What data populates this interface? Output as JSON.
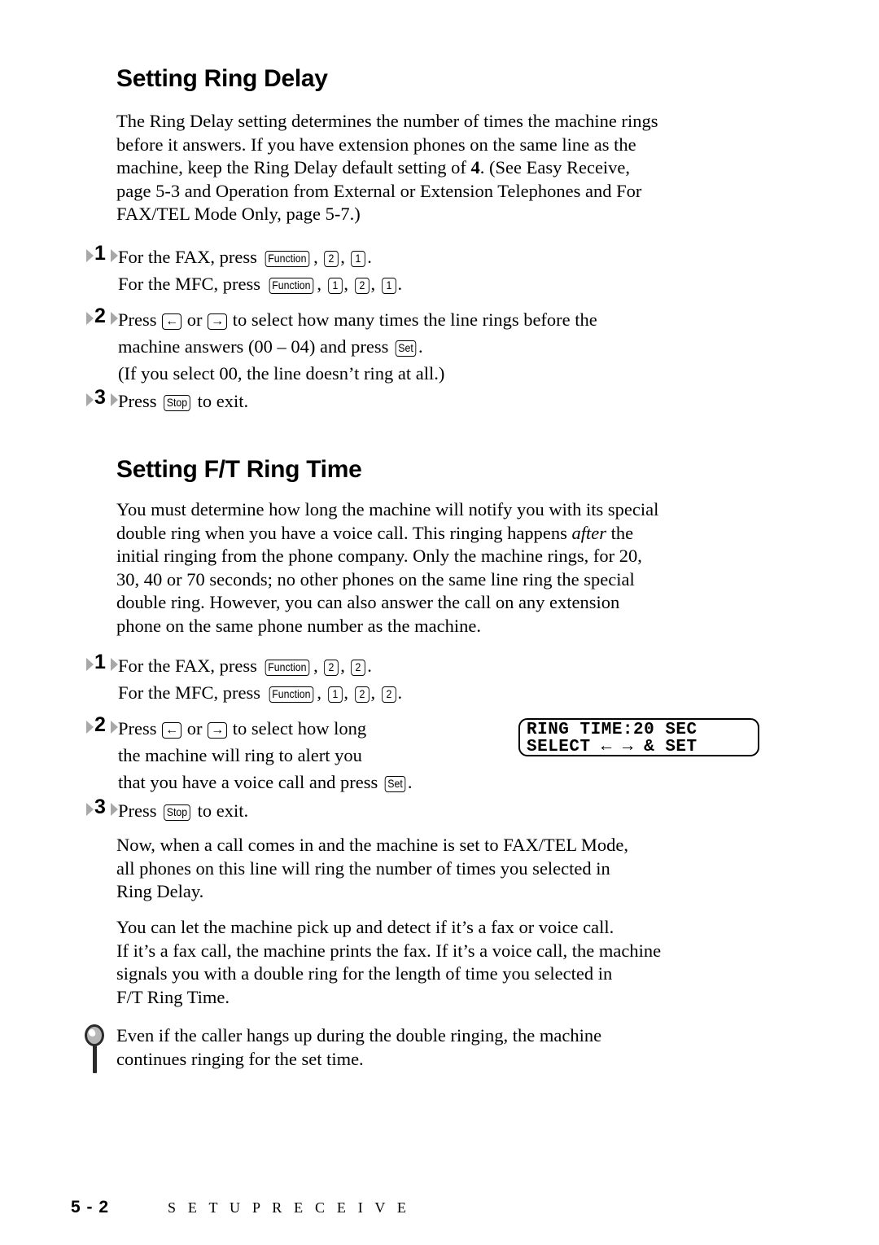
{
  "document": {
    "page_number": "5 - 2",
    "footer_title": "S E T U P   R E C E I V E"
  },
  "sections": [
    {
      "heading": "Setting Ring Delay",
      "intro_line1": "The Ring Delay setting determines the number of times the machine rings",
      "intro_line2": "before it answers.  If you have extension phones on the same line as the",
      "intro_line3a": "machine, keep the Ring Delay default setting of ",
      "intro_line3b": "4",
      "intro_line3c": ". (See Easy Receive,",
      "intro_line4": "page 5-3 and Operation from External or  Extension Telephones and For",
      "intro_line5": "FAX/TEL Mode Only, page 5-7.)",
      "steps": [
        {
          "number": "1",
          "line1_pre": "For the FAX, press ",
          "line1_keys": [
            "Function",
            "2",
            "1"
          ],
          "line1_post": ".",
          "line2_pre": "For the MFC, press ",
          "line2_keys": [
            "Function",
            "1",
            "2",
            "1"
          ],
          "line2_post": "."
        },
        {
          "number": "2",
          "a_pre": "Press ",
          "a_key_left": "←",
          "a_mid": " or ",
          "a_key_right": "→",
          "a_post": " to select how many times the line rings before the",
          "b_pre": "machine answers (00 – 04) and press ",
          "b_key": "Set",
          "b_post": ".",
          "c": "(If you select 00, the line doesn’t ring at all.)"
        },
        {
          "number": "3",
          "pre": "Press ",
          "key": "Stop",
          "post": " to exit."
        }
      ]
    },
    {
      "heading": "Setting F/T Ring Time",
      "intro_line1": "You must determine how long the machine will notify you with its special",
      "intro_line2a": "double ring when you have a voice call.  This ringing happens ",
      "intro_line2b": "after",
      "intro_line2c": " the",
      "intro_line3": "initial ringing from the phone company.  Only the machine rings, for 20,",
      "intro_line4": "30, 40 or 70 seconds; no other phones on the same line ring the special",
      "intro_line5": "double ring. However, you can also answer the call on any extension",
      "intro_line6": "phone on the same phone number as the machine.",
      "steps": [
        {
          "number": "1",
          "line1_pre": "For the FAX, press ",
          "line1_keys": [
            "Function",
            "2",
            "2"
          ],
          "line1_post": ".",
          "line2_pre": "For the MFC, press ",
          "line2_keys": [
            "Function",
            "1",
            "2",
            "2"
          ],
          "line2_post": "."
        },
        {
          "number": "2",
          "a_pre": "Press ",
          "a_key_left": "←",
          "a_mid": " or ",
          "a_key_right": "→",
          "a_post": " to select how long",
          "b": "the machine will ring to alert you",
          "c_pre": "that you have a voice call and press ",
          "c_key": "Set",
          "c_post": "."
        },
        {
          "number": "3",
          "pre": "Press ",
          "key": "Stop",
          "post": " to exit."
        }
      ],
      "after_paragraph_1": {
        "line1": "Now, when a call comes in and the machine is set to FAX/TEL Mode,",
        "line2": "all phones on this line will ring the number of times you selected in",
        "line3": "Ring Delay."
      },
      "after_paragraph_2": {
        "line1": "You can let the machine pick up and detect if it’s a fax or voice call.",
        "line2": "If it’s a fax call, the machine prints the fax. If it’s a voice call, the machine",
        "line3": "signals you with a double ring for the length of time you selected in",
        "line4": "F/T Ring Time."
      },
      "note": {
        "icon": "magnifier-icon",
        "line1": "Even if the caller hangs up during the double ringing, the machine",
        "line2": "continues ringing for the set time."
      }
    }
  ],
  "lcd_display": {
    "line1": "RING TIME:20 SEC",
    "line2": "SELECT ← → & SET"
  }
}
